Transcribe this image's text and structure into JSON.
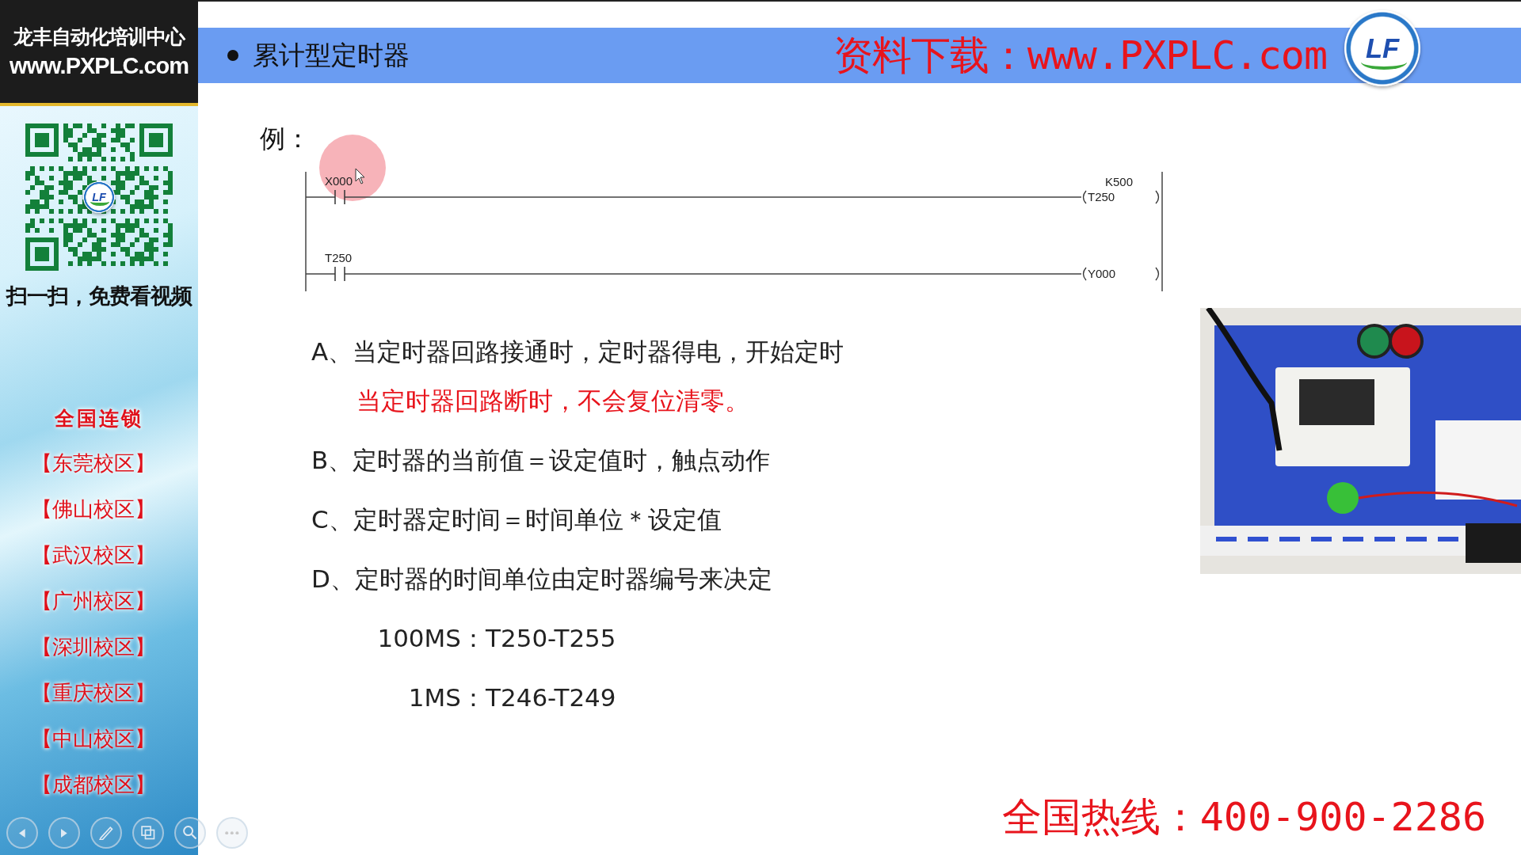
{
  "sidebar": {
    "brand_name": "龙丰自动化培训中心",
    "brand_url": "www.PXPLC.com",
    "qr_logo": "LF",
    "qr_caption": "扫一扫，免费看视频",
    "chain_title": "全国连锁",
    "campuses": [
      "【东莞校区】",
      "【佛山校区】",
      "【武汉校区】",
      "【广州校区】",
      "【深圳校区】",
      "【重庆校区】",
      "【中山校区】",
      "【成都校区】"
    ],
    "nav_controls": [
      {
        "kind": "previous"
      },
      {
        "kind": "next"
      },
      {
        "kind": "pen"
      },
      {
        "kind": "slides"
      },
      {
        "kind": "zoom"
      },
      {
        "kind": "more"
      }
    ]
  },
  "slide": {
    "title": "累计型定时器",
    "banner": "资料下载：www.PXPLC.com",
    "logo": "LF",
    "example_label": "例：",
    "pointer_highlight": true,
    "ladder": {
      "rungs": [
        {
          "contact": "X000",
          "coil": "T250",
          "setting": "K500"
        },
        {
          "contact": "T250",
          "coil": "Y000"
        }
      ]
    },
    "lines": [
      {
        "kind": "item",
        "text": "A、当定时器回路接通时，定时器得电，开始定时"
      },
      {
        "kind": "note",
        "text": "当定时器回路断时，不会复位清零。"
      },
      {
        "kind": "item",
        "text": "B、定时器的当前值＝设定值时，触点动作"
      },
      {
        "kind": "item",
        "text": "C、定时器定时间＝时间单位＊设定值"
      },
      {
        "kind": "item",
        "text": "D、定时器的时间单位由定时器编号来决定"
      },
      {
        "kind": "range",
        "label": "100MS：",
        "value": "T250-T255"
      },
      {
        "kind": "range",
        "label": "1MS：",
        "value": "T246-T249"
      }
    ],
    "hotline": "全国热线：400-900-2286"
  }
}
